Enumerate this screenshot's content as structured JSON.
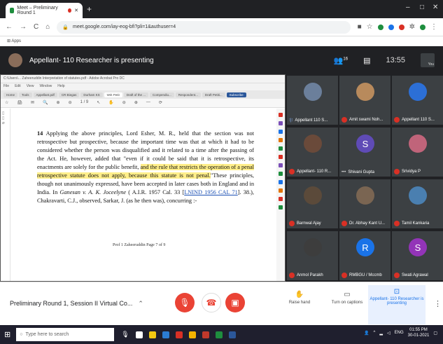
{
  "browser": {
    "tab_title": "Meet – Preliminary Round 1",
    "new_tab": "+",
    "minimize": "–",
    "maximize": "□",
    "close": "✕",
    "url": "meet.google.com/iay-eog-bfi?pli=1&authuser=4",
    "apps_label": "Apps"
  },
  "meet_header": {
    "presenting_text": "Appellant- 110 Researcher is presenting",
    "participant_count": "16",
    "time": "13:55",
    "you_label": "You"
  },
  "document": {
    "window_title": "C:\\Users\\... Zaheeruddin Interpretation of statutes.pdf - Adobe Acrobat Pro DC",
    "menu_items": [
      "File",
      "Edit",
      "View",
      "Window",
      "Help"
    ],
    "tabs": [
      "Home",
      "Tools",
      "Appellant.pdf",
      "CR Biegas",
      "Durham KS",
      "Writ Petit",
      "Draft of the ...",
      "Compendiu...",
      "Respondent...",
      "Draft Petiti..."
    ],
    "active_tab_index": 5,
    "subscribe_label": "Subscribe",
    "toolbar_items": [
      "☆",
      "🖨",
      "✉",
      "🔍",
      "⊕",
      "⊖",
      "1 / 9",
      "↖",
      "✋",
      "⊖",
      "⊕",
      "—",
      "⟳"
    ],
    "paragraph": {
      "number": "14",
      "before_highlight": " Applying the above principles, Lord Esher, M. R., held that the section was not retrospective but prospective, because the important time was that at which it had to be considered whether the person was disqualified and it related to a time after the passing of the Act. He, however, added that \"even if it could be said that it is retrospective, its enactments are solely for the public benefit, ",
      "highlight": "and the rule that restricts the operation of a penal retrospective statute does not apply, because this statute is not penal.",
      "after_highlight": "\"These principles, though not unanimously expressed, have been accepted in later cases both in England and in India. In ",
      "case_italic": "Ganesan v. A. K. Joceelyne",
      "citation": " ( A.I.R. 1957 Cal. 33 [",
      "link": "LNIND 1956 CAL 71",
      "after_link": "]. 38.), Chakravarti, C.J., observed, Sarkar, J. (as he then was), concurring :-"
    },
    "footer": "Prof 1 Zaheeruddin Page 7 of 9"
  },
  "participants": [
    {
      "name": "Appellant 110 S...",
      "avatar_type": "photo",
      "color": "#6b7f9b",
      "mic": "on"
    },
    {
      "name": "Amit swami Noh...",
      "avatar_type": "photo",
      "color": "#b88a5c",
      "mic": "off"
    },
    {
      "name": "Appellant 110 S...",
      "avatar_type": "photo",
      "color": "#2c6fd6",
      "mic": "off"
    },
    {
      "name": "Appellant- 110 R...",
      "avatar_type": "photo",
      "color": "#6a4a3a",
      "mic": "off"
    },
    {
      "name": "Shivani Gupta",
      "avatar_type": "letter",
      "letter": "S",
      "color": "#5f4bb6",
      "mic": "none"
    },
    {
      "name": "Srividya P",
      "avatar_type": "photo",
      "color": "#c0647a",
      "mic": "off"
    },
    {
      "name": "Barnwal Ajay",
      "avatar_type": "photo",
      "color": "#5b4a3a",
      "mic": "off"
    },
    {
      "name": "Dr. Abhay Kant U...",
      "avatar_type": "photo",
      "color": "#7a6552",
      "mic": "off"
    },
    {
      "name": "Tamil Kankaria",
      "avatar_type": "photo",
      "color": "#4a7fb0",
      "mic": "off"
    },
    {
      "name": "Anmol Parakh",
      "avatar_type": "photo",
      "color": "#3d3d3d",
      "mic": "off"
    },
    {
      "name": "RMBGU / Mccmb",
      "avatar_type": "letter",
      "letter": "R",
      "color": "#1a73e8",
      "mic": "off"
    },
    {
      "name": "Swati Agrawal",
      "avatar_type": "letter",
      "letter": "S",
      "color": "#9334b8",
      "mic": "off"
    }
  ],
  "controls": {
    "meeting_title": "Preliminary Round 1, Session II Virtual Co...",
    "raise_hand": "Raise hand",
    "captions": "Turn on captions",
    "presenting": "Appellant- 110 Researcher is presenting"
  },
  "taskbar": {
    "search_placeholder": "Type here to search",
    "lang": "ENG",
    "time": "01:55 PM",
    "date": "30-01-2021"
  }
}
